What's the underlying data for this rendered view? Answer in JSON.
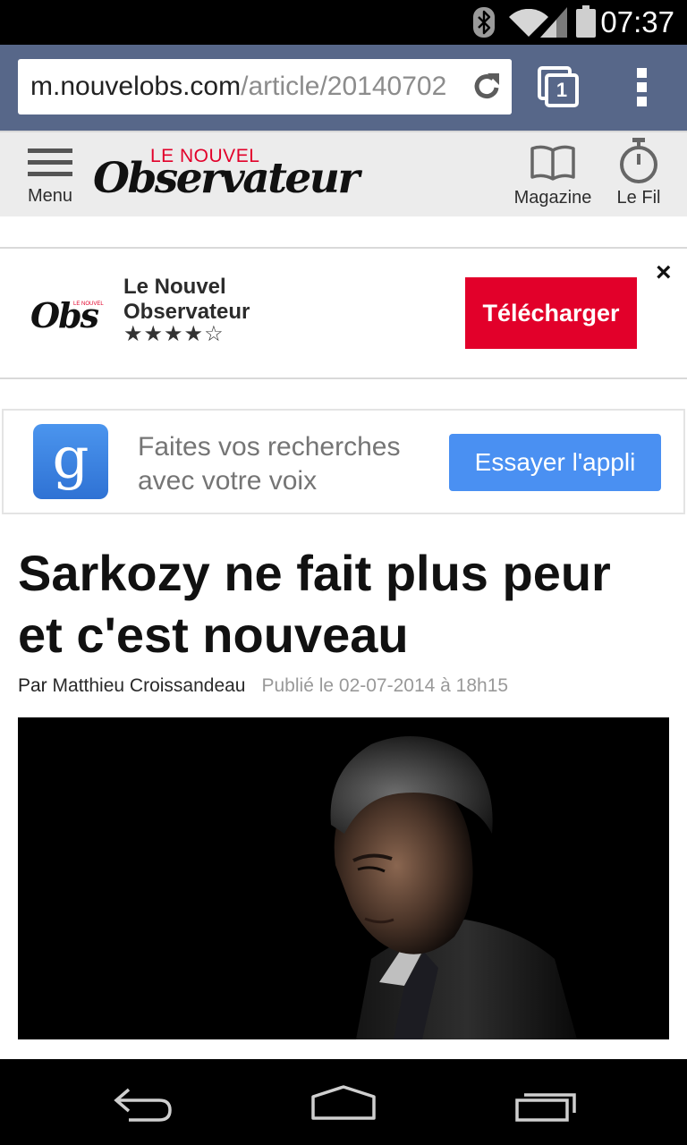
{
  "status_bar": {
    "time": "07:37"
  },
  "browser": {
    "url_host": "m.nouvelobs.com",
    "url_path": "/article/20140702",
    "tab_count": "1"
  },
  "site_header": {
    "menu_label": "Menu",
    "logo_small": "LE NOUVEL",
    "logo_main": "Observateur",
    "magazine_label": "Magazine",
    "feed_label": "Le Fil"
  },
  "app_banner": {
    "logo_text": "Obs",
    "logo_small": "LE NOUVEL",
    "app_name": "Le Nouvel Observateur",
    "stars": "★★★★☆",
    "rating": 4,
    "rating_max": 5,
    "download_label": "Télécharger",
    "close_label": "×"
  },
  "google_ad": {
    "icon_letter": "g",
    "text": "Faites vos recherches avec votre voix",
    "button_label": "Essayer l'appli"
  },
  "article": {
    "title": "Sarkozy ne fait plus peur et c'est nouveau",
    "byline_prefix": "Par",
    "author": "Matthieu Croissandeau",
    "published": "Publié le 02-07-2014 à 18h15"
  },
  "colors": {
    "status_bar": "#000000",
    "browser_bar": "#576789",
    "header_bg": "#ececec",
    "logo_red": "#e2002a",
    "download_button": "#e2002a",
    "ad_button": "#4a90f2",
    "google_icon": "#3b82e0"
  },
  "icons": {
    "status": [
      "bluetooth-icon",
      "wifi-icon",
      "signal-icon",
      "battery-icon"
    ],
    "browser": [
      "reload-icon",
      "tabs-icon",
      "overflow-menu-icon"
    ],
    "header": [
      "hamburger-icon",
      "book-icon",
      "stopwatch-icon"
    ],
    "nav": [
      "back-icon",
      "home-icon",
      "recents-icon"
    ]
  }
}
